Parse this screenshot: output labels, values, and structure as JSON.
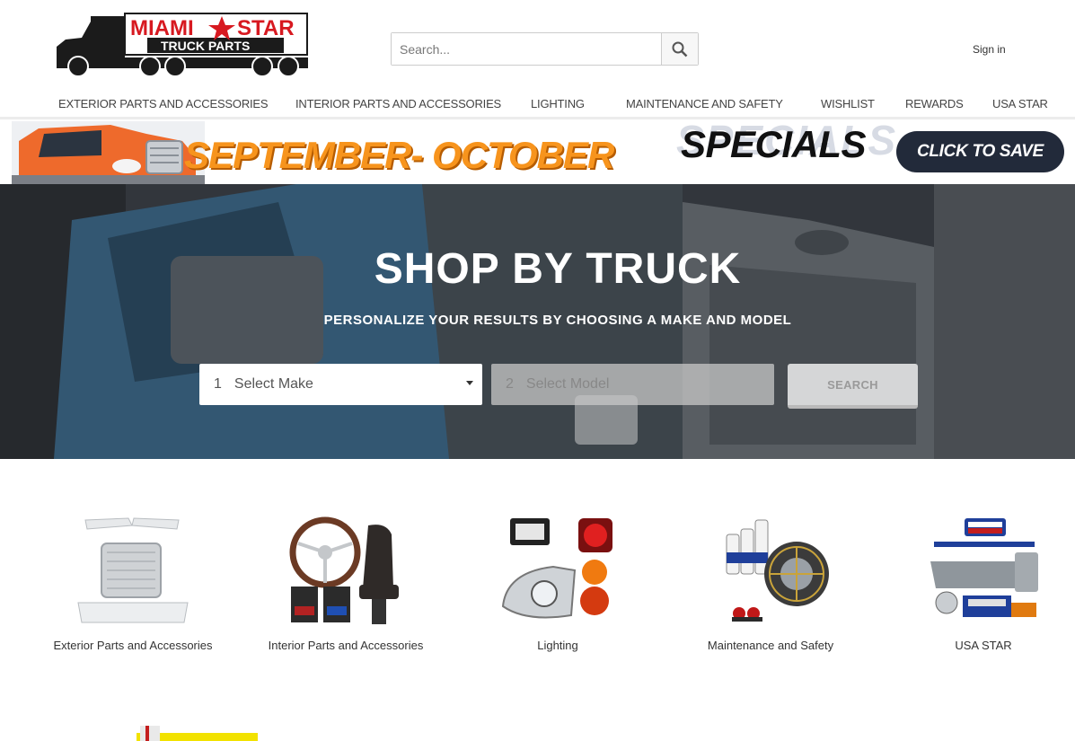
{
  "header": {
    "logo_alt": "MIAMI STAR TRUCK PARTS",
    "logo_line1": "MIAMI",
    "logo_line2": "STAR",
    "logo_line3": "TRUCK PARTS",
    "search_placeholder": "Search...",
    "signin": "Sign in"
  },
  "nav": {
    "items": [
      {
        "label": "EXTERIOR PARTS AND ACCESSORIES"
      },
      {
        "label": "INTERIOR PARTS AND ACCESSORIES"
      },
      {
        "label": "LIGHTING"
      },
      {
        "label": "MAINTENANCE AND SAFETY"
      },
      {
        "label": "WISHLIST"
      },
      {
        "label": "REWARDS"
      },
      {
        "label": "USA STAR"
      }
    ]
  },
  "banner": {
    "title": "SEPTEMBER- OCTOBER",
    "specials": "SPECIALS",
    "cta": "CLICK TO SAVE"
  },
  "hero": {
    "title": "SHOP BY TRUCK",
    "subtitle": "PERSONALIZE YOUR RESULTS BY CHOOSING A MAKE AND MODEL",
    "make_num": "1",
    "make_label": "Select Make",
    "model_num": "2",
    "model_label": "Select Model",
    "search_label": "SEARCH"
  },
  "categories": [
    {
      "label": "Exterior Parts and Accessories"
    },
    {
      "label": "Interior Parts and Accessories"
    },
    {
      "label": "Lighting"
    },
    {
      "label": "Maintenance and Safety"
    },
    {
      "label": "USA STAR"
    }
  ],
  "colors": {
    "brand_red": "#d71920",
    "banner_orange": "#f7941d",
    "cta_navy": "#222a3a"
  }
}
